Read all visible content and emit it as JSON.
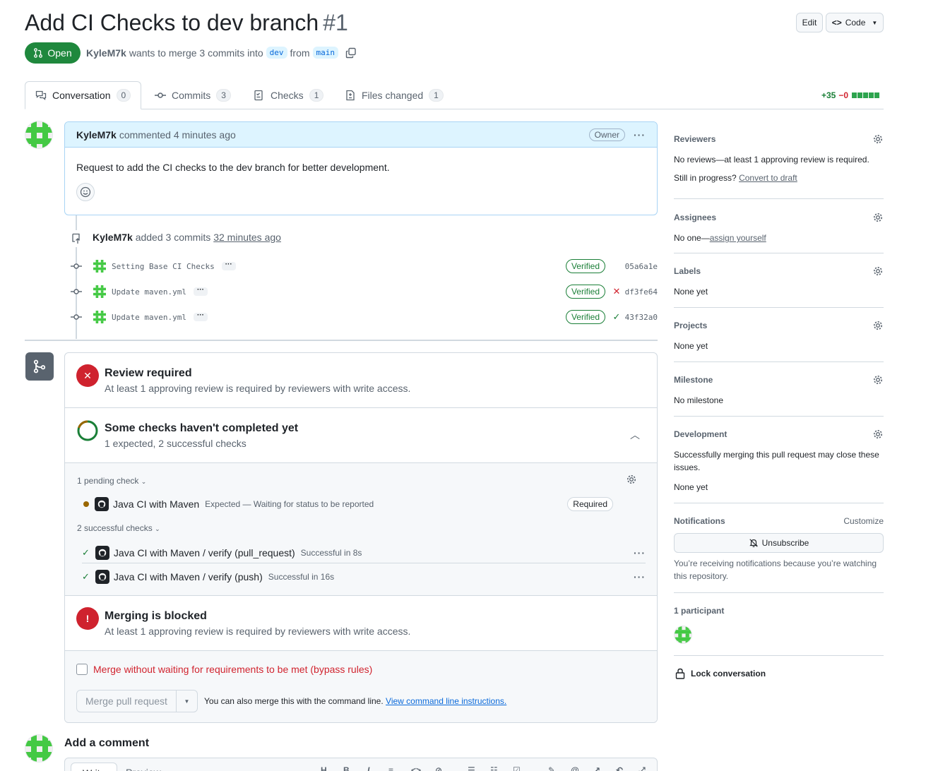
{
  "header": {
    "title": "Add CI Checks to dev branch",
    "number": "#1",
    "edit_label": "Edit",
    "code_label": "Code",
    "state_label": "Open",
    "author": "KyleM7k",
    "merge_text_1": "wants to merge 3 commits into",
    "base_branch": "dev",
    "merge_text_2": "from",
    "head_branch": "main"
  },
  "tabs": [
    {
      "label": "Conversation",
      "count": "0"
    },
    {
      "label": "Commits",
      "count": "3"
    },
    {
      "label": "Checks",
      "count": "1"
    },
    {
      "label": "Files changed",
      "count": "1"
    }
  ],
  "diffstat": {
    "additions": "+35",
    "deletions": "−0"
  },
  "comment": {
    "author": "KyleM7k",
    "meta": "commented 4 minutes ago",
    "role": "Owner",
    "body": "Request to add the CI checks to the dev branch for better development."
  },
  "commits_event": {
    "author": "KyleM7k",
    "text": "added 3 commits",
    "time": "32 minutes ago"
  },
  "commits": [
    {
      "message": "Setting Base CI Checks",
      "verified": "Verified",
      "status": "",
      "sha": "05a6a1e"
    },
    {
      "message": "Update maven.yml",
      "verified": "Verified",
      "status": "failure",
      "sha": "df3fe64"
    },
    {
      "message": "Update maven.yml",
      "verified": "Verified",
      "status": "success",
      "sha": "43f32a0"
    }
  ],
  "merge_box": {
    "review_title": "Review required",
    "review_sub": "At least 1 approving review is required by reviewers with write access.",
    "checks_title": "Some checks haven't completed yet",
    "checks_sub": "1 expected, 2 successful checks",
    "pending_toggle": "1 pending check",
    "pending_checks": [
      {
        "name": "Java CI with Maven",
        "desc": "Expected — Waiting for status to be reported",
        "badge": "Required"
      }
    ],
    "success_toggle": "2 successful checks",
    "success_checks": [
      {
        "name": "Java CI with Maven / verify (pull_request)",
        "desc": "Successful in 8s"
      },
      {
        "name": "Java CI with Maven / verify (push)",
        "desc": "Successful in 16s"
      }
    ],
    "blocked_title": "Merging is blocked",
    "blocked_sub": "At least 1 approving review is required by reviewers with write access.",
    "bypass_label": "Merge without waiting for requirements to be met (bypass rules)",
    "merge_button": "Merge pull request",
    "cli_text": "You can also merge this with the command line.",
    "cli_link": "View command line instructions."
  },
  "sidebar": {
    "reviewers": {
      "title": "Reviewers",
      "text": "No reviews—at least 1 approving review is required.",
      "draft_prefix": "Still in progress?",
      "draft_link": "Convert to draft"
    },
    "assignees": {
      "title": "Assignees",
      "text": "No one—",
      "link": "assign yourself"
    },
    "labels": {
      "title": "Labels",
      "text": "None yet"
    },
    "projects": {
      "title": "Projects",
      "text": "None yet"
    },
    "milestone": {
      "title": "Milestone",
      "text": "No milestone"
    },
    "development": {
      "title": "Development",
      "text": "Successfully merging this pull request may close these issues.",
      "value": "None yet"
    },
    "notifications": {
      "title": "Notifications",
      "customize": "Customize",
      "button": "Unsubscribe",
      "text": "You’re receiving notifications because you’re watching this repository."
    },
    "participants": {
      "title": "1 participant"
    },
    "lock": "Lock conversation"
  },
  "footer": {
    "add_comment": "Add a comment",
    "write_tab": "Write",
    "preview_tab": "Preview"
  },
  "colors": {
    "open_green": "#1f883d",
    "link_blue": "#0969da",
    "danger_red": "#cf222e",
    "identicon_green": "#44c944"
  }
}
